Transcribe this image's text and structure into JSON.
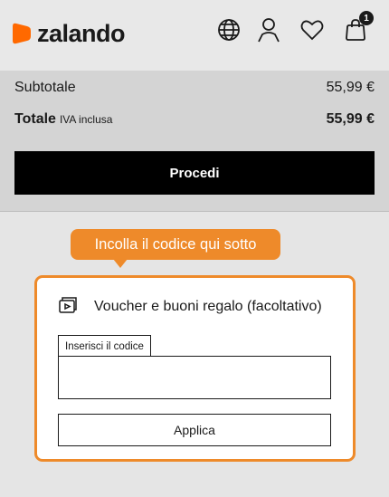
{
  "header": {
    "brand": "zalando",
    "brand_color": "#ff6900",
    "icons": [
      "language-globe-icon",
      "account-person-icon",
      "wishlist-heart-icon",
      "cart-bag-icon"
    ],
    "cart_count": "1"
  },
  "summary": {
    "subtotal_label": "Subtotale",
    "subtotal_value": "55,99 €",
    "total_label": "Totale",
    "total_note": "IVA inclusa",
    "total_value": "55,99 €",
    "proceed_label": "Procedi"
  },
  "tooltip": {
    "text": "Incolla il codice qui sotto",
    "color": "#ee8a2a"
  },
  "voucher": {
    "icon": "voucher-card-icon",
    "title": "Voucher e buoni regalo (facoltativo)",
    "input_label": "Inserisci il codice",
    "input_value": "",
    "apply_label": "Applica"
  }
}
